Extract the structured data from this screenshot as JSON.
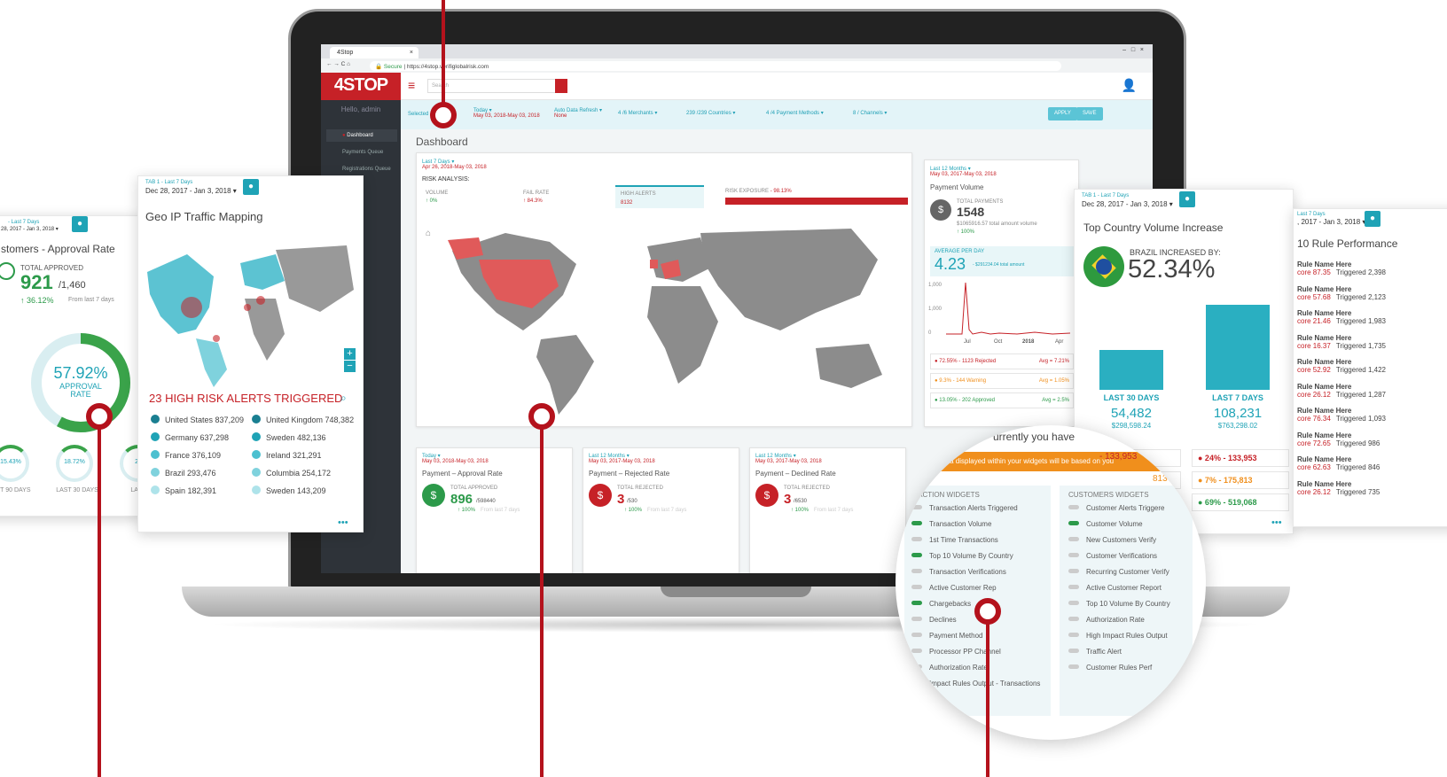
{
  "browser": {
    "tab_title": "4Stop",
    "url": "https://4stop.verifiglobalrisk.com",
    "secure_label": "Secure"
  },
  "app": {
    "logo": "4STOP",
    "hello": "Hello, admin",
    "search_placeholder": "Search"
  },
  "sidebar": {
    "items": [
      "Dashboard",
      "Payments Queue",
      "Registrations Queue"
    ]
  },
  "filters": {
    "selected": "Selected",
    "date_label": "Today ▾",
    "date_value": "May 03, 2018-May 03, 2018",
    "refresh_label": "Auto Data Refresh ▾",
    "refresh_value": "None",
    "merchants": "4 /6 Merchants ▾",
    "countries": "239 /239 Countries ▾",
    "payment": "4 /4 Payment Methods ▾",
    "channels": "8 / Channels ▾",
    "apply": "APPLY",
    "save": "SAVE"
  },
  "dashboard": {
    "title": "Dashboard"
  },
  "risk": {
    "range_label": "Last 7 Days ▾",
    "range": "Apr 26, 2018-May 03, 2018",
    "title": "RISK ANALYSIS:",
    "volume_label": "VOLUME",
    "volume": "↑ 0%",
    "fail_label": "FAIL RATE",
    "fail": "↑ 84.3%",
    "alerts_label": "HIGH ALERTS",
    "alerts": "8132",
    "exposure_label": "RISK EXPOSURE",
    "exposure": "- 98.13%"
  },
  "payment_volume": {
    "range_label": "Last 12 Months ▾",
    "range": "May 03, 2017-May 03, 2018",
    "title": "Payment Volume",
    "total_label": "TOTAL PAYMENTS",
    "total": "1548",
    "amount": "$1065916.57",
    "amount_note": "total amount volume",
    "change": "↑ 100%",
    "avg_label": "AVERAGE PER DAY",
    "avg": "4.23",
    "avg_amount": "- $291234.04 total amount",
    "y_ticks": [
      "1,000",
      "1,000",
      "0"
    ],
    "x_ticks": [
      "Jul",
      "Oct",
      "2018",
      "Apr"
    ],
    "stats": [
      {
        "text": "72.55% - 1123 Rejected",
        "avg": "Avg = 7.21%",
        "color": "#c62127"
      },
      {
        "text": "9.3% - 144 Warning",
        "avg": "Avg = 1.05%",
        "color": "#f08f1c"
      },
      {
        "text": "13.05% - 202 Approved",
        "avg": "Avg = 2.5%",
        "color": "#2c9a4a"
      }
    ]
  },
  "bottom_cards": [
    {
      "range_label": "Today ▾",
      "range": "May 03, 2018-May 03, 2018",
      "title": "Payment – Approval Rate",
      "stat_label": "TOTAL APPROVED",
      "value": "896",
      "total": "/598440",
      "change": "↑ 100%",
      "note": "From last 7 days",
      "color": "#2c9a4a"
    },
    {
      "range_label": "Last 12 Months ▾",
      "range": "May 03, 2017-May 03, 2018",
      "title": "Payment – Rejected Rate",
      "stat_label": "TOTAL REJECTED",
      "value": "3",
      "total": "/530",
      "change": "↑ 100%",
      "note": "From last 7 days",
      "color": "#c62127"
    },
    {
      "range_label": "Last 12 Months ▾",
      "range": "May 03, 2017-May 03, 2018",
      "title": "Payment – Declined Rate",
      "stat_label": "TOTAL REJECTED",
      "value": "3",
      "total": "/6530",
      "change": "↑ 100%",
      "note": "From last 7 days",
      "color": "#c62127"
    }
  ],
  "approval_widget": {
    "tab": "- Last 7 Days",
    "range": "28, 2017 - Jan 3, 2018 ▾",
    "title": "stomers - Approval Rate",
    "total_label": "TOTAL APPROVED",
    "value": "921",
    "total": "/1,460",
    "change": "↑ 36.12%",
    "note": "From last 7 days",
    "rate": "57.92%",
    "rate_label1": "APPROVAL",
    "rate_label2": "RATE",
    "rate_fraction": 0.5792,
    "small": [
      {
        "val": "15.43%",
        "label": "ST 90 DAYS"
      },
      {
        "val": "18.72%",
        "label": "LAST 30 DAYS"
      },
      {
        "val": "28",
        "label": "LAST 7"
      }
    ]
  },
  "geo_widget": {
    "tab": "TAB 1 - Last 7 Days",
    "range": "Dec 28, 2017 - Jan 3, 2018 ▾",
    "title": "Geo IP Traffic Mapping",
    "alerts": "23 HIGH RISK ALERTS TRIGGERED",
    "countries": [
      {
        "name": "United States 837,209",
        "color": "#1a7f91"
      },
      {
        "name": "United Kingdom 748,382",
        "color": "#1a7f91"
      },
      {
        "name": "Germany 637,298",
        "color": "#1fa3b6"
      },
      {
        "name": "Sweden 482,136",
        "color": "#1fa3b6"
      },
      {
        "name": "France 376,109",
        "color": "#4cc0d0"
      },
      {
        "name": "Ireland 321,291",
        "color": "#4cc0d0"
      },
      {
        "name": "Brazil 293,476",
        "color": "#7fd2dd"
      },
      {
        "name": "Columbia 254,172",
        "color": "#7fd2dd"
      },
      {
        "name": "Spain 182,391",
        "color": "#aee3ea"
      },
      {
        "name": "Sweden 143,209",
        "color": "#aee3ea"
      }
    ],
    "more": "•••"
  },
  "country_widget": {
    "tab": "TAB 1 - Last 7 Days",
    "range": "Dec 28, 2017 - Jan 3, 2018 ▾",
    "title": "Top Country Volume Increase",
    "label": "BRAZIL INCREASED BY:",
    "value": "52.34%",
    "bars": [
      {
        "label": "LAST 30 DAYS",
        "value": "54,482",
        "amount": "$298,598.24",
        "height": 0.47
      },
      {
        "label": "LAST 7 DAYS",
        "value": "108,231",
        "amount": "$763,298.02",
        "height": 1.0
      }
    ],
    "stats": [
      {
        "text": "- 133,953",
        "color": "#c62127"
      },
      {
        "text": "24% - 133,953",
        "color": "#c62127"
      },
      {
        "text": "- 175,813",
        "color": "#f08f1c"
      },
      {
        "text": "7% - 175,813",
        "color": "#f08f1c"
      },
      {
        "text": "69% - 519,068",
        "color": "#2c9a4a"
      }
    ],
    "more": "•••"
  },
  "rules_widget": {
    "tab": "Last 7 Days",
    "range": ", 2017 - Jan 3, 2018 ▾",
    "title": "10 Rule Performance",
    "rows": [
      {
        "name": "Rule Name Here",
        "score": "core 87.35",
        "trig": "Triggered 2,398"
      },
      {
        "name": "Rule Name Here",
        "score": "core 57.68",
        "trig": "Triggered 2,123"
      },
      {
        "name": "Rule Name Here",
        "score": "core 21.46",
        "trig": "Triggered 1,983"
      },
      {
        "name": "Rule Name Here",
        "score": "core 16.37",
        "trig": "Triggered 1,735"
      },
      {
        "name": "Rule Name Here",
        "score": "core 52.92",
        "trig": "Triggered 1,422"
      },
      {
        "name": "Rule Name Here",
        "score": "core 26.12",
        "trig": "Triggered 1,287"
      },
      {
        "name": "Rule Name Here",
        "score": "core 76.34",
        "trig": "Triggered 1,093"
      },
      {
        "name": "Rule Name Here",
        "score": "core 72.65",
        "trig": "Triggered 986"
      },
      {
        "name": "Rule Name Here",
        "score": "core 62.63",
        "trig": "Triggered 846"
      },
      {
        "name": "Rule Name Here",
        "score": "core 26.12",
        "trig": "Triggered 735"
      }
    ]
  },
  "zoom": {
    "header": "urrently you have",
    "banner": "data displayed within your widgets will be based on you",
    "col1": "NSACTION WIDGETS",
    "col2": "CUSTOMERS WIDGETS",
    "peek1": "- 133,953",
    "peek2": "813",
    "left": [
      {
        "t": "Transaction Alerts Triggered",
        "on": false
      },
      {
        "t": "Transaction Volume",
        "on": true
      },
      {
        "t": "1st Time Transactions",
        "on": false
      },
      {
        "t": "Top 10 Volume By Country",
        "on": true
      },
      {
        "t": "Transaction Verifications",
        "on": false
      },
      {
        "t": "Active Customer Rep",
        "on": false
      },
      {
        "t": "Chargebacks",
        "on": true
      },
      {
        "t": "Declines",
        "on": false
      },
      {
        "t": "Payment Method",
        "on": false
      },
      {
        "t": "Processor PP Channel",
        "on": false
      },
      {
        "t": "Authorization Rate",
        "on": false
      },
      {
        "t": "Impact Rules Output - Transactions",
        "on": false
      }
    ],
    "right": [
      {
        "t": "Customer Alerts Triggere",
        "on": false
      },
      {
        "t": "Customer Volume",
        "on": true
      },
      {
        "t": "New Customers Verify",
        "on": false
      },
      {
        "t": "Customer Verifications",
        "on": false
      },
      {
        "t": "Recurring Customer Verify",
        "on": false
      },
      {
        "t": "Active Customer Report",
        "on": false
      },
      {
        "t": "Top 10 Volume By Country",
        "on": false
      },
      {
        "t": "Authorization Rate",
        "on": false
      },
      {
        "t": "High Impact Rules Output",
        "on": false
      },
      {
        "t": "Traffic Alert",
        "on": false
      },
      {
        "t": "Customer Rules Perf",
        "on": false
      }
    ]
  }
}
